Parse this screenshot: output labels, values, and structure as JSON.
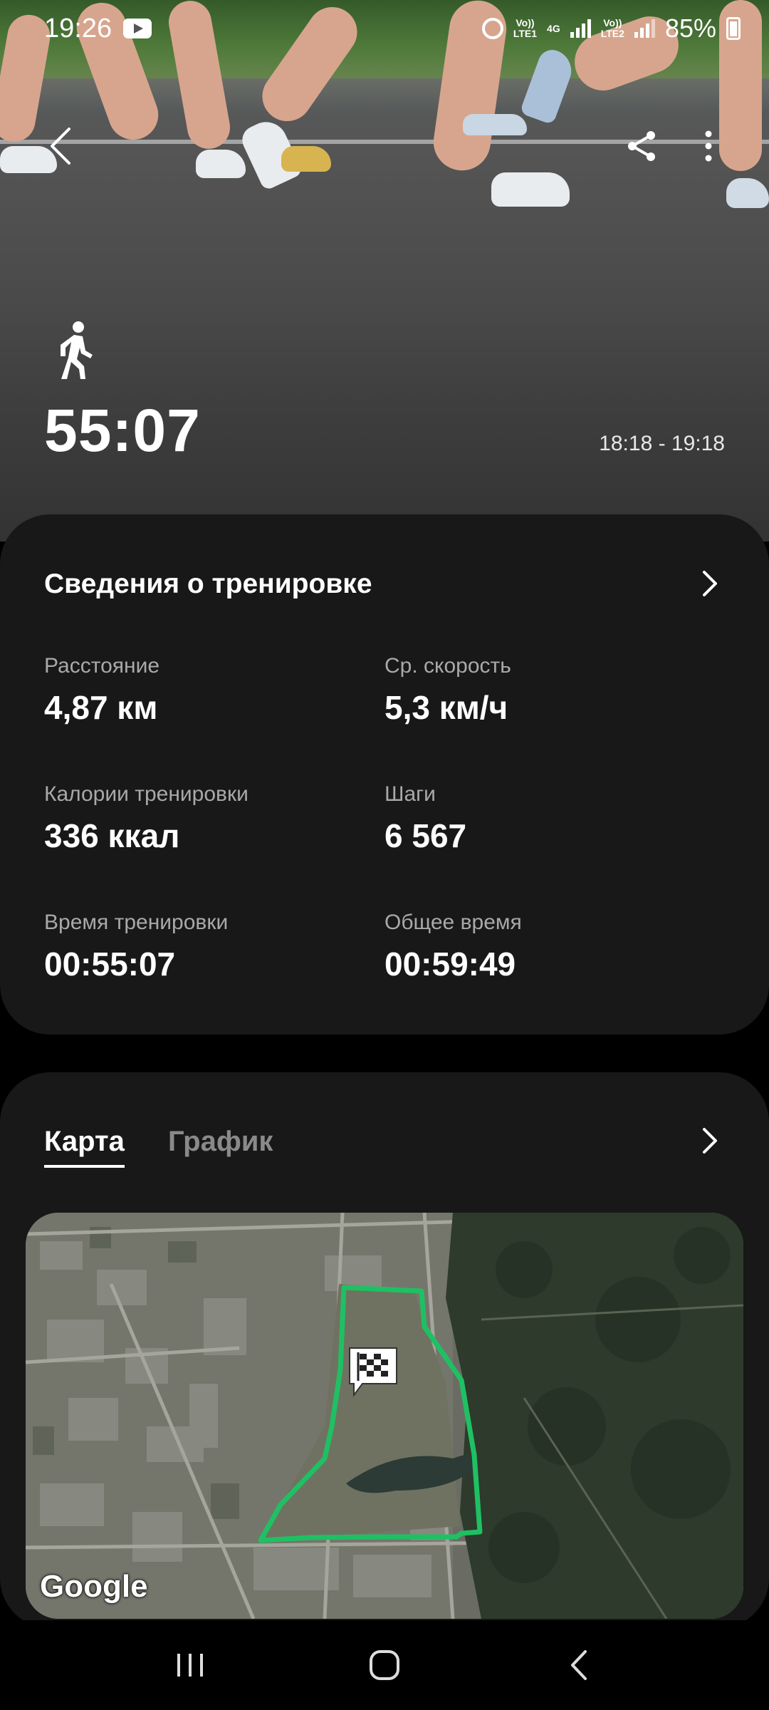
{
  "status_bar": {
    "time": "19:26",
    "lte1_top": "Vo))",
    "lte1_bottom": "LTE1",
    "net_type": "4G",
    "lte2_top": "Vo))",
    "lte2_bottom": "LTE2",
    "battery": "85%"
  },
  "header": {
    "activity_icon": "walking-icon",
    "duration": "55:07",
    "time_range": "18:18 - 19:18"
  },
  "details": {
    "title": "Сведения о тренировке",
    "stats": [
      {
        "label": "Расстояние",
        "value": "4,87 км"
      },
      {
        "label": "Ср. скорость",
        "value": "5,3 км/ч"
      },
      {
        "label": "Калории тренировки",
        "value": "336 ккал"
      },
      {
        "label": "Шаги",
        "value": "6 567"
      },
      {
        "label": "Время тренировки",
        "value": "00:55:07"
      },
      {
        "label": "Общее время",
        "value": "00:59:49"
      }
    ]
  },
  "map_card": {
    "tabs": [
      {
        "label": "Карта",
        "active": true
      },
      {
        "label": "График",
        "active": false
      }
    ],
    "map_attribution": "Google",
    "route_color": "#1fc063"
  },
  "colors": {
    "card_bg": "#181818",
    "label_gray": "#a9a9a9"
  }
}
